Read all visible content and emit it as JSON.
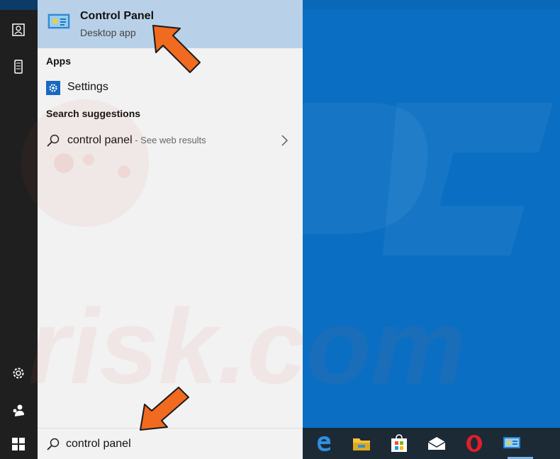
{
  "best_match": {
    "title": "Control Panel",
    "subtitle": "Desktop app"
  },
  "sections": {
    "apps": "Apps",
    "suggestions": "Search suggestions"
  },
  "apps": [
    {
      "label": "Settings"
    }
  ],
  "suggestions": [
    {
      "query": "control panel",
      "hint": " - See web results"
    }
  ],
  "search": {
    "value": "control panel"
  },
  "watermark": {
    "text": "PC risk.com"
  },
  "rail_icons": [
    "user-card-icon",
    "phone-icon",
    "settings-gear-icon",
    "people-icon",
    "windows-logo-icon"
  ],
  "taskbar_icons": [
    "edge-icon",
    "file-explorer-icon",
    "store-icon",
    "mail-icon",
    "opera-icon",
    "control-panel-icon"
  ],
  "colors": {
    "desktop": "#0a6fc2",
    "panel": "#f2f2f2",
    "best_match_highlight": "#b9d1e8",
    "rail": "#1f1f1f",
    "taskbar": "#1c2a36",
    "arrow": "#f06a1f"
  }
}
